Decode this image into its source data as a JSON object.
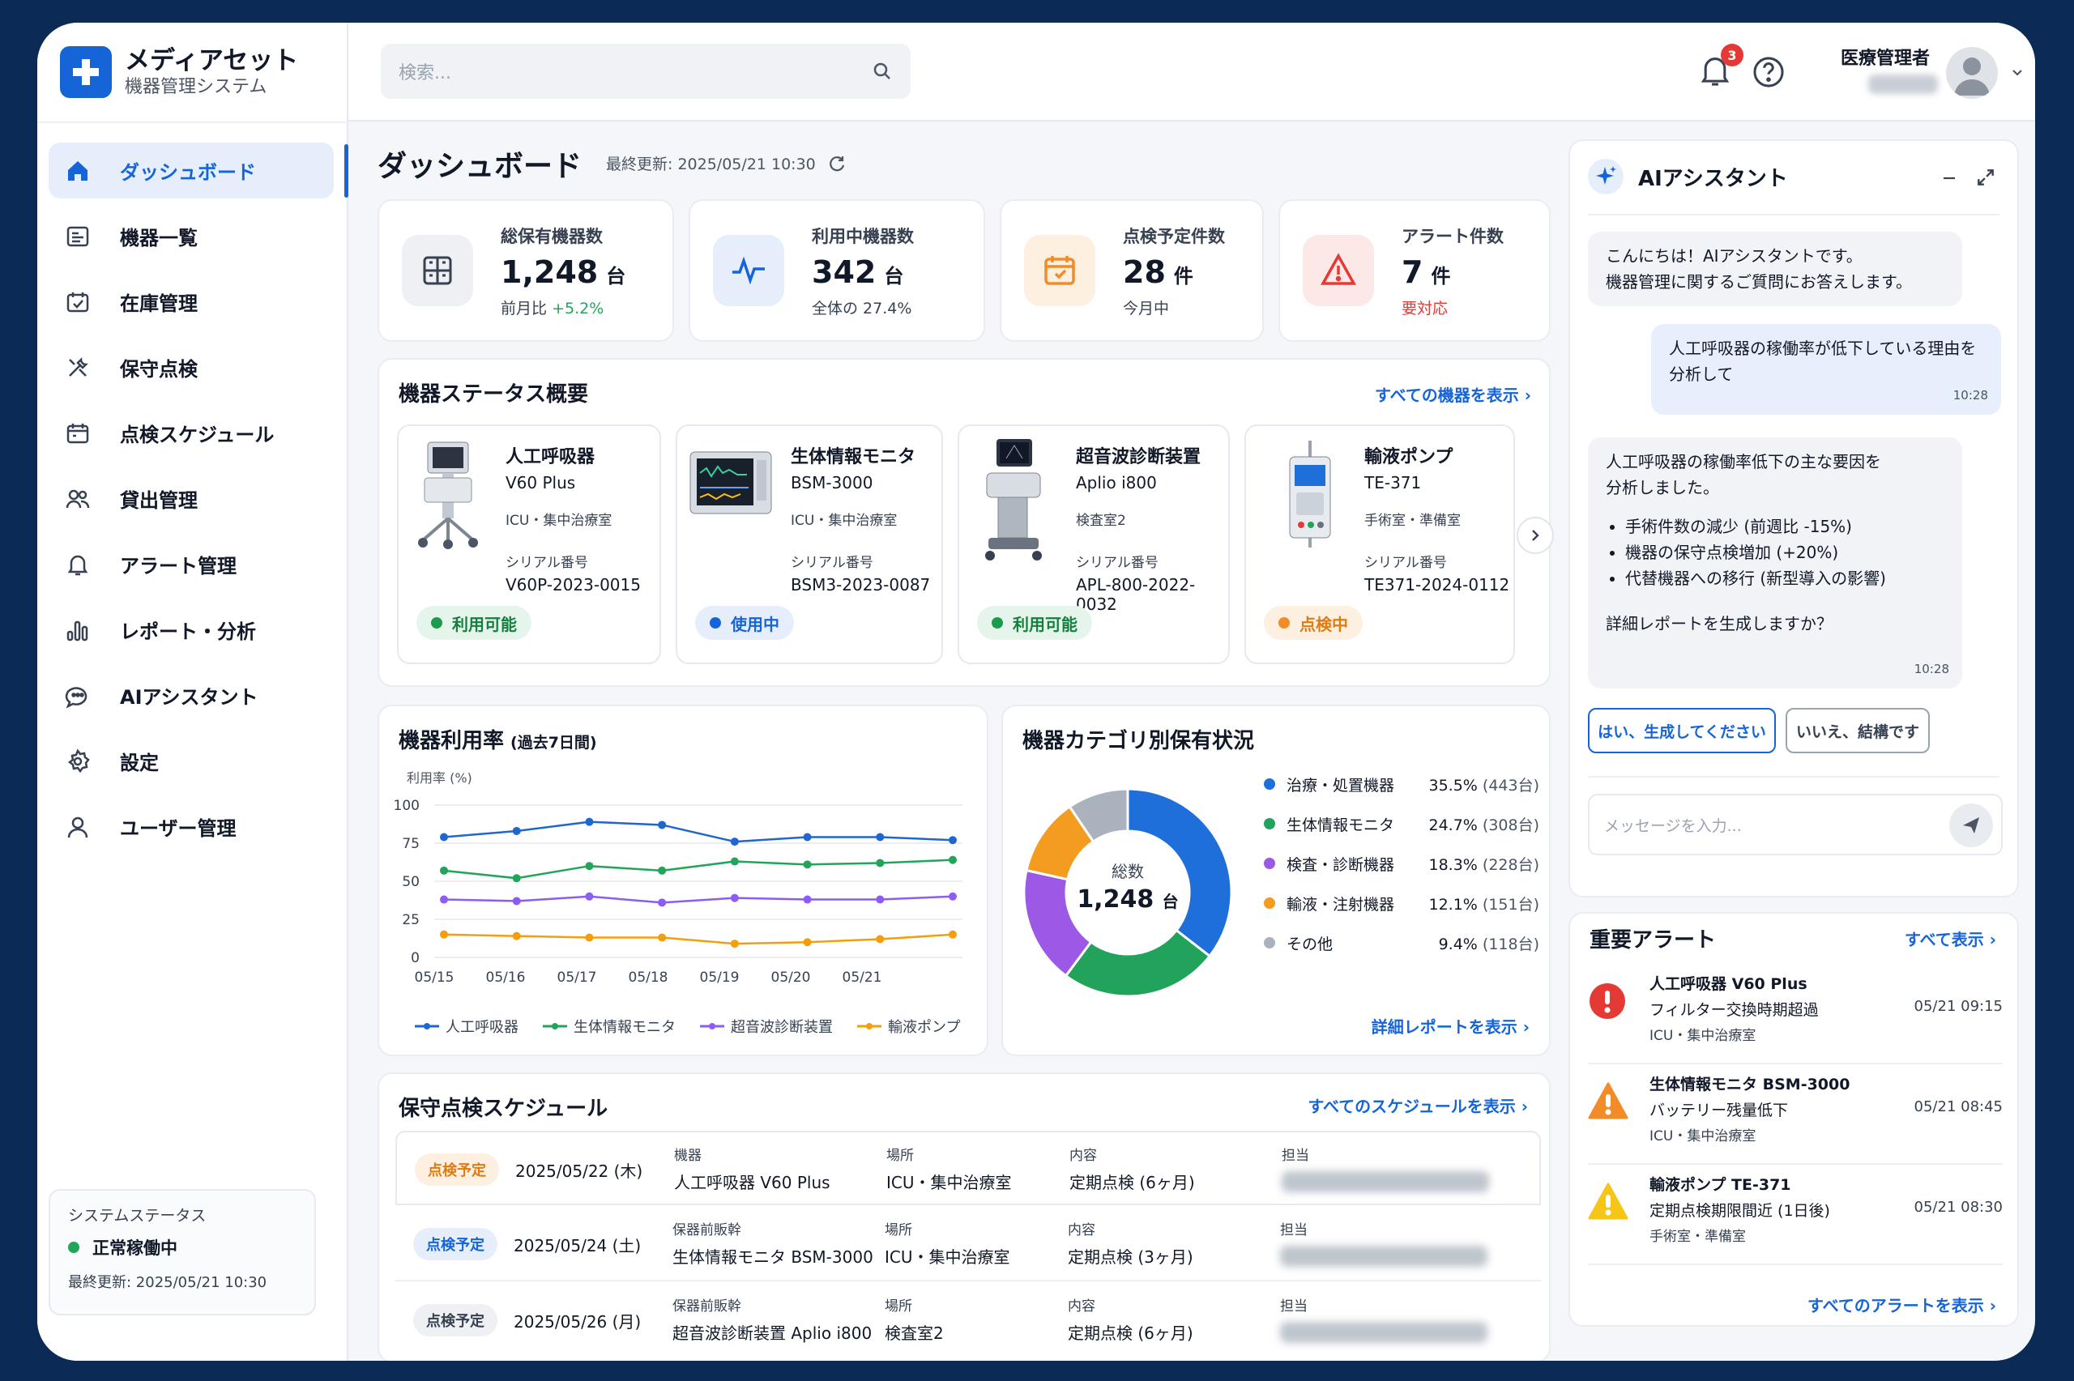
{
  "app": {
    "title": "メディアセット",
    "subtitle": "機器管理システム"
  },
  "nav": [
    {
      "label": "ダッシュボード",
      "icon": "home-icon"
    },
    {
      "label": "機器一覧",
      "icon": "device-list-icon"
    },
    {
      "label": "在庫管理",
      "icon": "inventory-icon"
    },
    {
      "label": "保守点検",
      "icon": "tools-icon"
    },
    {
      "label": "点検スケジュール",
      "icon": "calendar-icon"
    },
    {
      "label": "貸出管理",
      "icon": "users-icon"
    },
    {
      "label": "アラート管理",
      "icon": "bell-icon"
    },
    {
      "label": "レポート・分析",
      "icon": "chart-icon"
    },
    {
      "label": "AIアシスタント",
      "icon": "ai-chat-icon"
    },
    {
      "label": "設定",
      "icon": "gear-icon"
    },
    {
      "label": "ユーザー管理",
      "icon": "user-icon"
    }
  ],
  "system": {
    "title": "システムステータス",
    "status": "正常稼働中",
    "updated": "最終更新: 2025/05/21 10:30"
  },
  "search": {
    "placeholder": "検索..."
  },
  "topbar": {
    "notifications": "3",
    "user": "医療管理者"
  },
  "page": {
    "title": "ダッシュボード",
    "updated": "最終更新: 2025/05/21 10:30"
  },
  "kpis": [
    {
      "label": "総保有機器数",
      "value": "1,248",
      "unit": "台",
      "sub_prefix": "前月比",
      "sub_delta": "+5.2%"
    },
    {
      "label": "利用中機器数",
      "value": "342",
      "unit": "台",
      "sub": "全体の 27.4%"
    },
    {
      "label": "点検予定件数",
      "value": "28",
      "unit": "件",
      "sub": "今月中"
    },
    {
      "label": "アラート件数",
      "value": "7",
      "unit": "件",
      "sub": "要対応"
    }
  ],
  "status_overview": {
    "title": "機器ステータス概要",
    "link": "すべての機器を表示",
    "serial_label": "シリアル番号",
    "devices": [
      {
        "name": "人工呼吸器",
        "model": "V60 Plus",
        "location": "ICU・集中治療室",
        "serial": "V60P-2023-0015",
        "status": "利用可能"
      },
      {
        "name": "生体情報モニタ",
        "model": "BSM-3000",
        "location": "ICU・集中治療室",
        "serial": "BSM3-2023-0087",
        "status": "使用中"
      },
      {
        "name": "超音波診断装置",
        "model": "Aplio i800",
        "location": "検査室2",
        "serial": "APL-800-2022-0032",
        "status": "利用可能"
      },
      {
        "name": "輸液ポンプ",
        "model": "TE-371",
        "location": "手術室・準備室",
        "serial": "TE371-2024-0112",
        "status": "点検中"
      }
    ]
  },
  "utilization": {
    "title": "機器利用率",
    "title_suffix": "(過去7日間)"
  },
  "chart_data": [
    {
      "type": "line",
      "title": "機器利用率 (過去7日間)",
      "ylabel": "利用率 (%)",
      "x": [
        "05/15",
        "05/16",
        "05/17",
        "05/18",
        "05/19",
        "05/20",
        "05/21"
      ],
      "ylim": [
        0,
        100
      ],
      "yticks": [
        0,
        25,
        50,
        75,
        100
      ],
      "grid": true,
      "legend": "bottom",
      "series": [
        {
          "name": "人工呼吸器",
          "color": "#1e66d0",
          "values": [
            79,
            83,
            89,
            87,
            76,
            79,
            79,
            77
          ]
        },
        {
          "name": "生体情報モニタ",
          "color": "#22a559",
          "values": [
            57,
            52,
            60,
            57,
            63,
            61,
            62,
            64
          ]
        },
        {
          "name": "超音波診断装置",
          "color": "#8b5cf6",
          "values": [
            38,
            37,
            40,
            36,
            39,
            38,
            38,
            40
          ]
        },
        {
          "name": "輸液ポンプ",
          "color": "#f59e0b",
          "values": [
            15,
            14,
            13,
            13,
            9,
            10,
            12,
            15
          ]
        }
      ]
    },
    {
      "type": "pie",
      "title": "機器カテゴリ別保有状況",
      "center_label": "総数",
      "center_value": "1,248",
      "center_unit": "台",
      "slices": [
        {
          "label": "治療・処置機器",
          "pct": "35.5%",
          "count": "(443台)",
          "value": 443,
          "color": "#1e6fd9"
        },
        {
          "label": "生体情報モニタ",
          "pct": "24.7%",
          "count": "(308台)",
          "value": 308,
          "color": "#21a35b"
        },
        {
          "label": "検査・診断機器",
          "pct": "18.3%",
          "count": "(228台)",
          "value": 228,
          "color": "#9b59e6"
        },
        {
          "label": "輸液・注射機器",
          "pct": "12.1%",
          "count": "(151台)",
          "value": 151,
          "color": "#f39c1f"
        },
        {
          "label": "その他",
          "pct": "9.4%",
          "count": "(118台)",
          "value": 118,
          "color": "#aab2bd"
        }
      ]
    }
  ],
  "category": {
    "title": "機器カテゴリ別保有状況",
    "link": "詳細レポートを表示"
  },
  "schedule": {
    "title": "保守点検スケジュール",
    "link": "すべてのスケジュールを表示",
    "rows": [
      {
        "chip": "点検予定",
        "date": "2025/05/22 (木)",
        "h1": "機器",
        "device": "人工呼吸器 V60 Plus",
        "h2": "場所",
        "loc": "ICU・集中治療室",
        "h3": "内容",
        "content": "定期点検 (6ヶ月)",
        "h4": "担当"
      },
      {
        "chip": "点検予定",
        "date": "2025/05/24 (土)",
        "h1": "保器前販幹",
        "device": "生体情報モニタ BSM-3000",
        "h2": "場所",
        "loc": "ICU・集中治療室",
        "h3": "内容",
        "content": "定期点検 (3ヶ月)",
        "h4": "担当"
      },
      {
        "chip": "点検予定",
        "date": "2025/05/26 (月)",
        "h1": "保器前販幹",
        "device": "超音波診断装置 Aplio i800",
        "h2": "場所",
        "loc": "検査室2",
        "h3": "内容",
        "content": "定期点検 (6ヶ月)",
        "h4": "担当"
      }
    ]
  },
  "ai": {
    "title": "AIアシスタント",
    "greeting_1": "こんにちは！AIアシスタントです。",
    "greeting_2": "機器管理に関するご質問にお答えします。",
    "user_msg_1": "人工呼吸器の稼働率が低下している理由を",
    "user_msg_2": "分析して",
    "user_time": "10:28",
    "reply_1": "人工呼吸器の稼働率低下の主な要因を",
    "reply_2": "分析しました。",
    "bullets": [
      "手術件数の減少 (前週比 -15%)",
      "機器の保守点検増加 (+20%)",
      "代替機器への移行 (新型導入の影響)"
    ],
    "reply_q": "詳細レポートを生成しますか？",
    "reply_time": "10:28",
    "btn_yes": "はい、生成してください",
    "btn_no": "いいえ、結構です",
    "input_placeholder": "メッセージを入力..."
  },
  "alerts": {
    "title": "重要アラート",
    "link": "すべて表示",
    "footer": "すべてのアラートを表示",
    "items": [
      {
        "title": "人工呼吸器 V60 Plus",
        "desc": "フィルター交換時期超過",
        "loc": "ICU・集中治療室",
        "time": "05/21 09:15",
        "color": "#e53935"
      },
      {
        "title": "生体情報モニタ BSM-3000",
        "desc": "バッテリー残量低下",
        "loc": "ICU・集中治療室",
        "time": "05/21 08:45",
        "color": "#f28c28"
      },
      {
        "title": "輸液ポンプ TE-371",
        "desc": "定期点検期限間近 (1日後)",
        "loc": "手術室・準備室",
        "time": "05/21 08:30",
        "color": "#f5c518"
      }
    ]
  }
}
